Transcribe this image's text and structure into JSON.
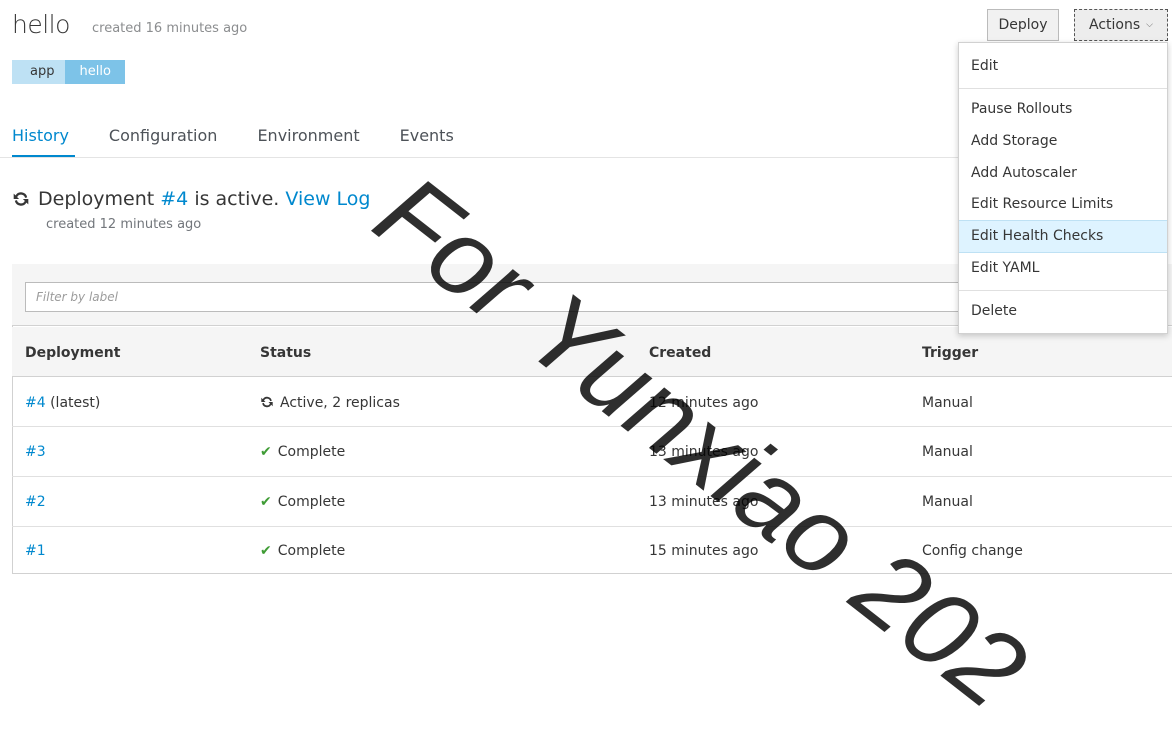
{
  "header": {
    "title": "hello",
    "subtitle": "created 16 minutes ago",
    "label_key": "app",
    "label_value": "hello",
    "deploy_label": "Deploy",
    "actions_label": "Actions"
  },
  "tabs": [
    {
      "label": "History",
      "active": true
    },
    {
      "label": "Configuration",
      "active": false
    },
    {
      "label": "Environment",
      "active": false
    },
    {
      "label": "Events",
      "active": false
    }
  ],
  "deployment": {
    "prefix": "Deployment ",
    "number": "#4",
    "suffix": " is active.",
    "view_log": "View Log",
    "created": "created 12 minutes ago"
  },
  "filter": {
    "placeholder": "Filter by label"
  },
  "table": {
    "columns": [
      "Deployment",
      "Status",
      "Created",
      "Trigger"
    ],
    "rows": [
      {
        "id": "#4",
        "extra": " (latest)",
        "status": "Active, 2 replicas",
        "status_icon": "sync-icon",
        "created": "12 minutes ago",
        "trigger": "Manual"
      },
      {
        "id": "#3",
        "extra": "",
        "status": "Complete",
        "status_icon": "check-icon",
        "created": "13 minutes ago",
        "trigger": "Manual"
      },
      {
        "id": "#2",
        "extra": "",
        "status": "Complete",
        "status_icon": "check-icon",
        "created": "13 minutes ago",
        "trigger": "Manual"
      },
      {
        "id": "#1",
        "extra": "",
        "status": "Complete",
        "status_icon": "check-icon",
        "created": "15 minutes ago",
        "trigger": "Config change"
      }
    ]
  },
  "actions_menu": {
    "items": [
      "Edit",
      "Pause Rollouts",
      "Add Storage",
      "Add Autoscaler",
      "Edit Resource Limits",
      "Edit Health Checks",
      "Edit YAML",
      "Delete"
    ],
    "highlighted": "Edit Health Checks"
  },
  "watermark": "For Yunxiao 202",
  "colors": {
    "link": "#0088ce",
    "success": "#3f9c35",
    "label_key_bg": "#bee1f4",
    "label_value_bg": "#7dc3e8"
  }
}
